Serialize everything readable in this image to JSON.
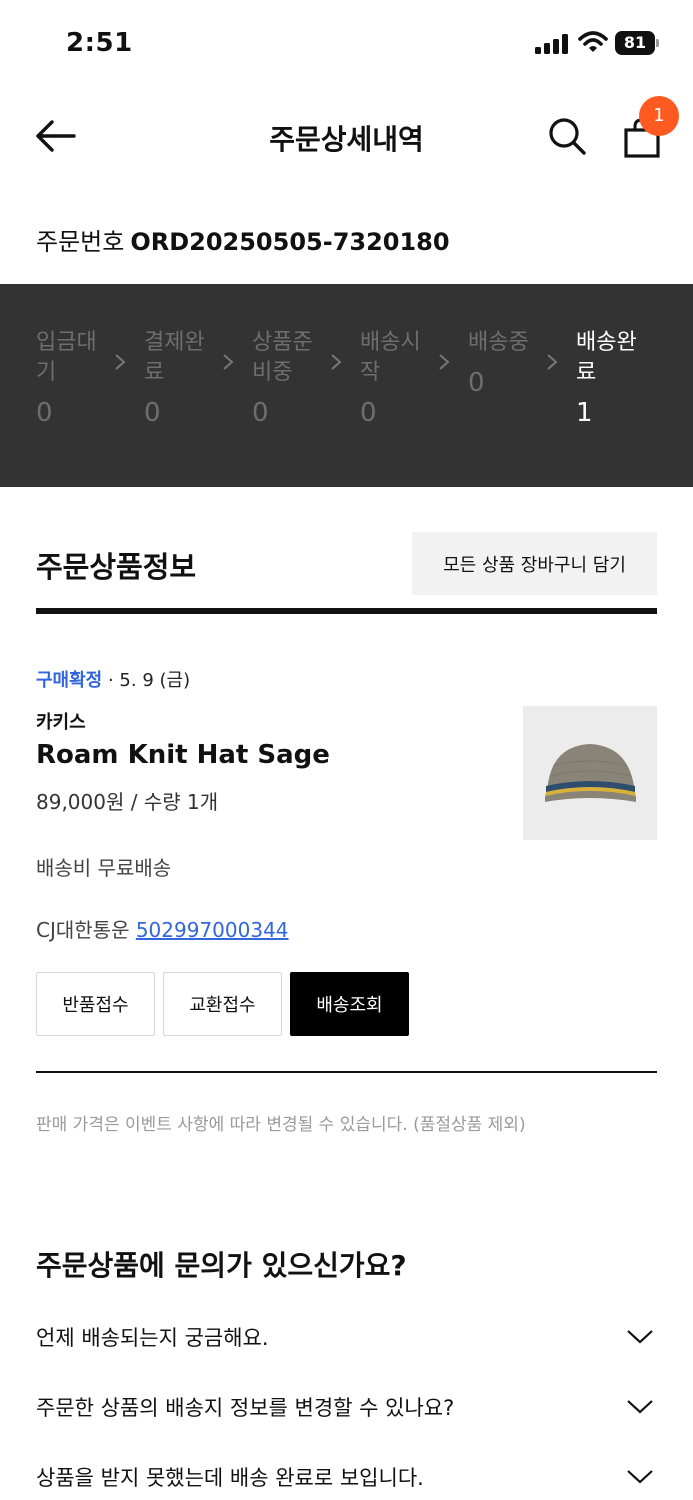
{
  "status_bar": {
    "time": "2:51",
    "battery": "81"
  },
  "header": {
    "title": "주문상세내역",
    "cart_badge": "1"
  },
  "order": {
    "number_label": "주문번호",
    "number_value": "ORD20250505-7320180"
  },
  "progress": {
    "steps": [
      {
        "label": "입금대기",
        "count": "0",
        "active": false
      },
      {
        "label": "결제완료",
        "count": "0",
        "active": false
      },
      {
        "label": "상품준비중",
        "count": "0",
        "active": false
      },
      {
        "label": "배송시작",
        "count": "0",
        "active": false
      },
      {
        "label": "배송중",
        "count": "0",
        "active": false
      },
      {
        "label": "배송완료",
        "count": "1",
        "active": true
      }
    ]
  },
  "order_items": {
    "section_title": "주문상품정보",
    "add_all_to_cart_label": "모든 상품 장바구니 담기",
    "item": {
      "status": "구매확정",
      "separator": " · ",
      "date": "5. 9 (금)",
      "brand": "카키스",
      "name": "Roam Knit Hat Sage",
      "price_qty": "89,000원 / 수량 1개",
      "shipping_fee": "배송비 무료배송",
      "carrier": "CJ대한통운",
      "tracking_number": "502997000344",
      "buttons": {
        "return": "반품접수",
        "exchange": "교환접수",
        "track": "배송조회"
      }
    },
    "notice": "판매 가격은 이벤트 사항에 따라 변경될 수 있습니다. (품절상품 제외)"
  },
  "faq": {
    "title": "주문상품에 문의가 있으신가요?",
    "items": [
      "언제 배송되는지 궁금해요.",
      "주문한 상품의 배송지 정보를 변경할 수 있나요?",
      "상품을 받지 못했는데 배송 완료로 보입니다."
    ]
  },
  "colors": {
    "accent_blue": "#3366dd",
    "badge_orange": "#ff5a1f",
    "progress_bg": "#333333"
  }
}
